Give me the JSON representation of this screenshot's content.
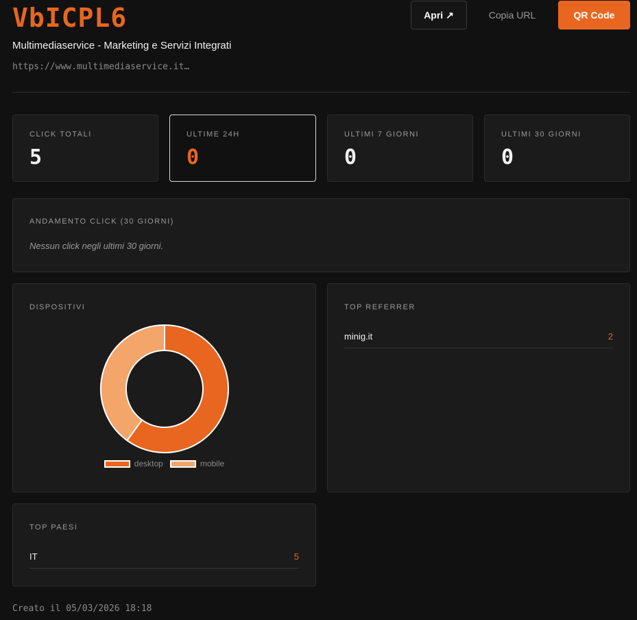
{
  "header": {
    "title": "VbICPL6",
    "subtitle": "Multimediaservice - Marketing e Servizi Integrati",
    "url": "https://www.multimediaservice.it…",
    "buttons": {
      "open": "Apri ↗",
      "copy": "Copia URL",
      "qr": "QR Code"
    }
  },
  "stats": [
    {
      "label": "CLICK TOTALI",
      "value": "5"
    },
    {
      "label": "ULTIME 24H",
      "value": "0"
    },
    {
      "label": "ULTIMI 7 GIORNI",
      "value": "0"
    },
    {
      "label": "ULTIMI 30 GIORNI",
      "value": "0"
    }
  ],
  "trend": {
    "label": "ANDAMENTO CLICK (30 GIORNI)",
    "empty": "Nessun click negli ultimi 30 giorni."
  },
  "devices": {
    "label": "DISPOSITIVI"
  },
  "chart_data": {
    "type": "pie",
    "categories": [
      "desktop",
      "mobile"
    ],
    "values": [
      3,
      2
    ],
    "colors": [
      "#e8661f",
      "#f3a56a"
    ],
    "legend": "bottom",
    "donut": true
  },
  "referrers": {
    "label": "TOP REFERRER",
    "items": [
      {
        "name": "minig.it",
        "count": "2"
      }
    ]
  },
  "countries": {
    "label": "TOP PAESI",
    "items": [
      {
        "name": "IT",
        "count": "5"
      }
    ]
  },
  "footer": "Creato il 05/03/2026 18:18"
}
